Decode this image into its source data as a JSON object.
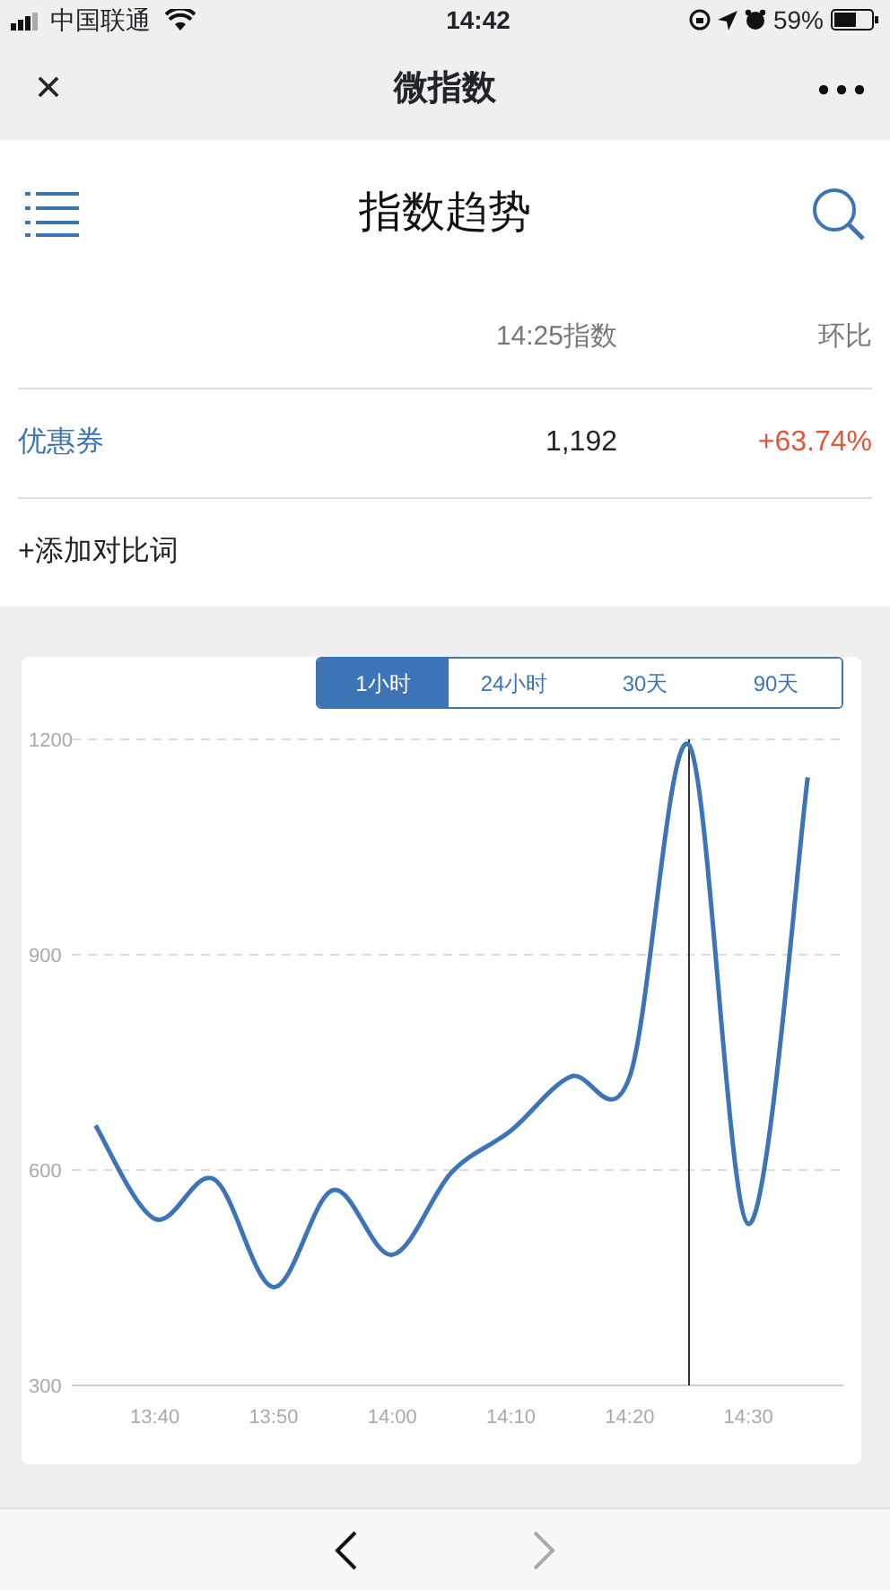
{
  "status_bar": {
    "carrier": "中国联通",
    "time": "14:42",
    "battery": "59%"
  },
  "nav": {
    "close": "×",
    "title": "微指数"
  },
  "header": {
    "title": "指数趋势"
  },
  "table": {
    "columns": [
      "14:25指数",
      "环比"
    ],
    "rows": [
      {
        "keyword": "优惠券",
        "value": "1,192",
        "change": "+63.74%"
      }
    ]
  },
  "add_link": "+添加对比词",
  "range_tabs": [
    {
      "label": "1小时",
      "selected": true
    },
    {
      "label": "24小时",
      "selected": false
    },
    {
      "label": "30天",
      "selected": false
    },
    {
      "label": "90天",
      "selected": false
    }
  ],
  "chart_data": {
    "type": "line",
    "x": [
      815,
      820,
      825,
      830,
      835,
      840,
      845,
      850,
      855,
      860,
      865,
      870,
      875
    ],
    "series": [
      {
        "color": "#3d74b5",
        "values": [
          662,
          532,
          587,
          437,
          572,
          482,
          597,
          655,
          730,
          730,
          1192,
          525,
          1147
        ]
      }
    ],
    "xlim": [
      813,
      878
    ],
    "ylim": [
      300,
      1200
    ],
    "xticks": [
      {
        "value": 820,
        "label": "13:40"
      },
      {
        "value": 830,
        "label": "13:50"
      },
      {
        "value": 840,
        "label": "14:00"
      },
      {
        "value": 850,
        "label": "14:10"
      },
      {
        "value": 860,
        "label": "14:20"
      },
      {
        "value": 870,
        "label": "14:30"
      }
    ],
    "yticks": [
      300,
      600,
      900,
      1200
    ],
    "ref_lines": [
      {
        "axis": "x",
        "value": 865
      }
    ]
  }
}
